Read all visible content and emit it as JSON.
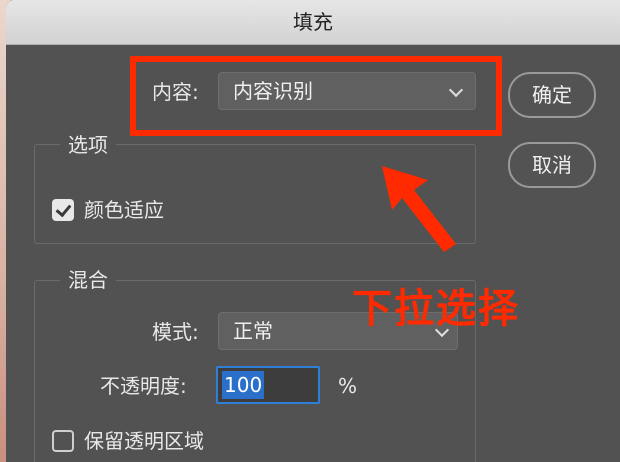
{
  "dialog": {
    "title": "填充",
    "content_label": "内容:",
    "content_value": "内容识别",
    "ok_label": "确定",
    "cancel_label": "取消",
    "options_group": "选项",
    "color_adapt_label": "颜色适应",
    "color_adapt_checked": true,
    "blend_group": "混合",
    "mode_label": "模式:",
    "mode_value": "正常",
    "opacity_label": "不透明度:",
    "opacity_value": "100",
    "opacity_unit": "%",
    "preserve_transparency_label": "保留透明区域",
    "preserve_transparency_checked": false
  },
  "annotation": {
    "text": "下拉选择",
    "color": "#ff2a00"
  }
}
